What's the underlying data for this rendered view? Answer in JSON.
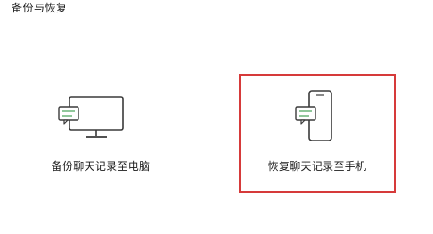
{
  "window": {
    "title": "备份与恢复"
  },
  "cards": {
    "backup": {
      "label": "备份聊天记录至电脑",
      "icon": "monitor-chat-icon"
    },
    "restore": {
      "label": "恢复聊天记录至手机",
      "icon": "phone-chat-icon",
      "highlighted": true
    }
  },
  "colors": {
    "icon_stroke": "#3a3a3a",
    "chat_bubble": "#8fc79a",
    "highlight_border": "#d63a3a"
  }
}
